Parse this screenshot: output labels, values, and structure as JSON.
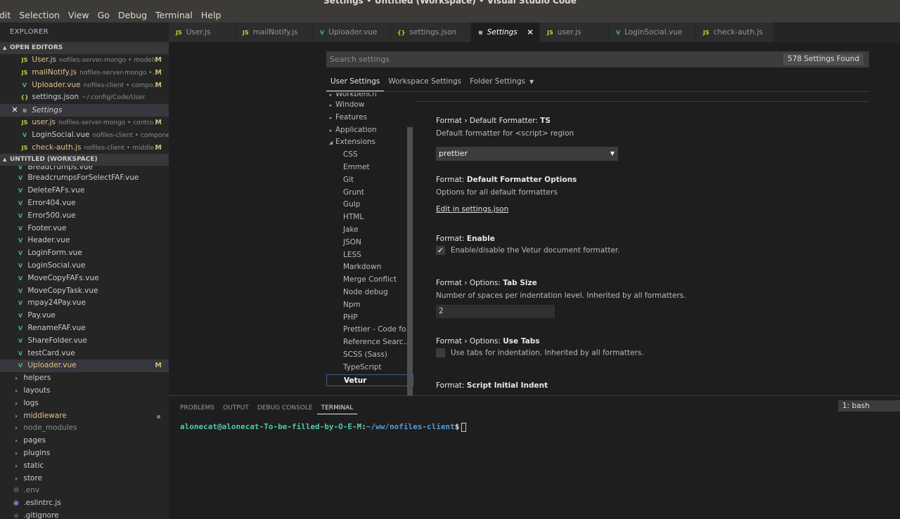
{
  "window": {
    "title": "Settings • Untitled (Workspace) • Visual Studio Code"
  },
  "menu": [
    "dit",
    "Selection",
    "View",
    "Go",
    "Debug",
    "Terminal",
    "Help"
  ],
  "sidebar": {
    "title": "EXPLORER",
    "open_editors_label": "OPEN EDITORS",
    "open_editors": [
      {
        "icon": "JS",
        "name": "User.js",
        "desc": "nofiles-server-mongo • models",
        "badge": "M"
      },
      {
        "icon": "JS",
        "name": "mailNotify.js",
        "desc": "nofiles-server-mongo •...",
        "badge": "M"
      },
      {
        "icon": "V",
        "name": "Uploader.vue",
        "desc": "nofiles-client • compo...",
        "badge": "M"
      },
      {
        "icon": "{}",
        "name": "settings.json",
        "desc": "~/.config/Code/User",
        "badge": ""
      },
      {
        "icon": "≡",
        "name": "Settings",
        "desc": "",
        "badge": ""
      },
      {
        "icon": "JS",
        "name": "user.js",
        "desc": "nofiles-server-mongo • contro...",
        "badge": "M"
      },
      {
        "icon": "V",
        "name": "LoginSocial.vue",
        "desc": "nofiles-client • components",
        "badge": ""
      },
      {
        "icon": "JS",
        "name": "check-auth.js",
        "desc": "nofiles-client • middle...",
        "badge": "M"
      }
    ],
    "workspace_label": "UNTITLED (WORKSPACE)",
    "files": [
      "Breadcrumps.vue",
      "BreadcrumpsForSelectFAF.vue",
      "DeleteFAFs.vue",
      "Error404.vue",
      "Error500.vue",
      "Footer.vue",
      "Header.vue",
      "LoginForm.vue",
      "LoginSocial.vue",
      "MoveCopyFAFs.vue",
      "MoveCopyTask.vue",
      "mpay24Pay.vue",
      "Pay.vue",
      "RenameFAF.vue",
      "ShareFolder.vue",
      "testCard.vue",
      "Uploader.vue"
    ],
    "uploader_badge": "M",
    "folders": [
      "helpers",
      "layouts",
      "logs",
      "middleware",
      "node_modules",
      "pages",
      "plugins",
      "static",
      "store"
    ],
    "dotfiles": [
      ".env",
      ".eslintrc.js",
      ".gitignore"
    ]
  },
  "tabs": [
    {
      "icon": "JS",
      "label": "User.js"
    },
    {
      "icon": "JS",
      "label": "mailNotify.js"
    },
    {
      "icon": "V",
      "label": "Uploader.vue"
    },
    {
      "icon": "{}",
      "label": "settings.json"
    },
    {
      "icon": "≡",
      "label": "Settings"
    },
    {
      "icon": "JS",
      "label": "user.js"
    },
    {
      "icon": "V",
      "label": "LoginSocial.vue"
    },
    {
      "icon": "JS",
      "label": "check-auth.js"
    }
  ],
  "settings_editor": {
    "search_placeholder": "Search settings",
    "found_badge": "578 Settings Found",
    "scope_tabs": [
      "User Settings",
      "Workspace Settings",
      "Folder Settings"
    ],
    "toc_top": [
      "Workbench",
      "Window",
      "Features",
      "Application",
      "Extensions"
    ],
    "toc_extensions": [
      "CSS",
      "Emmet",
      "Git",
      "Grunt",
      "Gulp",
      "HTML",
      "Jake",
      "JSON",
      "LESS",
      "Markdown",
      "Merge Conflict",
      "Node debug",
      "Npm",
      "PHP",
      "Prettier - Code for...",
      "Reference Search ...",
      "SCSS (Sass)",
      "TypeScript",
      "Vetur"
    ],
    "items": {
      "s1": {
        "prefix": "Format › Default Formatter: ",
        "name": "TS",
        "desc": "Default formatter for <script> region",
        "value": "prettier"
      },
      "s2": {
        "prefix": "Format: ",
        "name": "Default Formatter Options",
        "desc": "Options for all default formatters",
        "link": "Edit in settings.json"
      },
      "s3": {
        "prefix": "Format: ",
        "name": "Enable",
        "cb_label": "Enable/disable the Vetur document formatter.",
        "checked": true
      },
      "s4": {
        "prefix": "Format › Options: ",
        "name": "Tab Size",
        "desc": "Number of spaces per indentation level. Inherited by all formatters.",
        "value": "2"
      },
      "s5": {
        "prefix": "Format › Options: ",
        "name": "Use Tabs",
        "cb_label": "Use tabs for indentation. Inherited by all formatters.",
        "checked": false
      },
      "s6": {
        "prefix": "Format: ",
        "name": "Script Initial Indent"
      }
    }
  },
  "panel": {
    "tabs": [
      "PROBLEMS",
      "OUTPUT",
      "DEBUG CONSOLE",
      "TERMINAL"
    ],
    "terminal_select": "1: bash",
    "prompt_user": "alonecat@alonecat-To-be-filled-by-O-E-M",
    "prompt_path": "~/ww/nofiles-client",
    "prompt_sign": "$"
  },
  "colors": {
    "vue": "#41b883",
    "js": "#cbcb41",
    "modified": "#e2c08d",
    "accent": "#4ec9b0"
  }
}
